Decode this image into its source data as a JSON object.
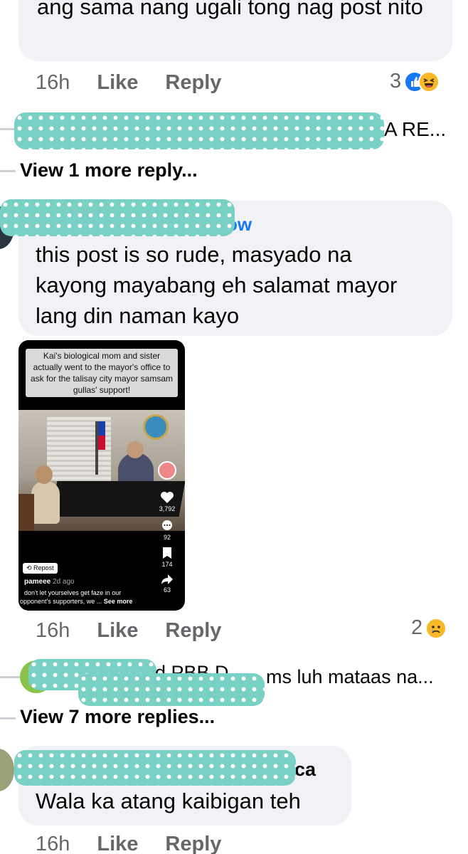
{
  "comments": [
    {
      "text": "ang sama nang ugali tong nag post nito",
      "time": "16h",
      "like": "Like",
      "reply": "Reply",
      "reaction_count": "3"
    },
    {
      "reply_preview_suffix": "A RE...",
      "view_more": "View 1 more reply..."
    },
    {
      "name_suffix": "ow",
      "text": "this post is so rude, masyado na kayong mayabang eh salamat mayor lang din naman kayo",
      "time": "16h",
      "like": "Like",
      "reply": "Reply",
      "reaction_count": "2"
    },
    {
      "reply_preview_suffix": "ms luh mataas na...",
      "reply_preview_fragment": "d PBB D",
      "view_more": "View 7 more replies..."
    },
    {
      "name_suffix": "ca",
      "text": "Wala ka atang kaibigan teh",
      "time": "16h",
      "like": "Like",
      "reply": "Reply"
    }
  ],
  "attachment": {
    "caption": "Kai's biological mom and sister actually went to the mayor's office to ask for the talisay city mayor samsam gullas' support!",
    "likes": "3,792",
    "comments": "92",
    "saves": "174",
    "shares": "63",
    "repost": "Repost",
    "user": "pameee",
    "age": "2d ago",
    "desc_line1": "don't let yourselves get faze in our",
    "desc_line2": "opponent's supporters, we ...",
    "see_more": "See more"
  },
  "reaction_icons": [
    "like-icon",
    "haha-icon",
    "sad-icon"
  ]
}
